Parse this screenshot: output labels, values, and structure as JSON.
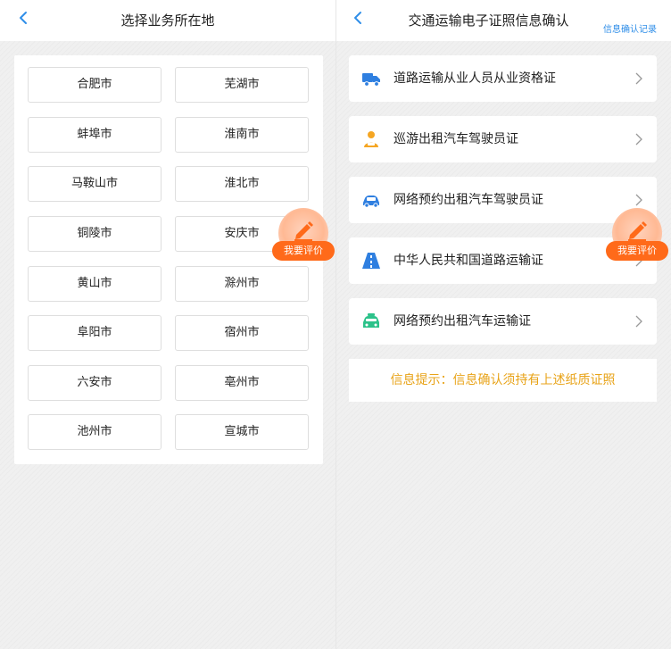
{
  "left": {
    "title": "选择业务所在地",
    "cities": [
      "合肥市",
      "芜湖市",
      "蚌埠市",
      "淮南市",
      "马鞍山市",
      "淮北市",
      "铜陵市",
      "安庆市",
      "黄山市",
      "滁州市",
      "阜阳市",
      "宿州市",
      "六安市",
      "亳州市",
      "池州市",
      "宣城市"
    ]
  },
  "right": {
    "title": "交通运输电子证照信息确认",
    "record_link": "信息确认记录",
    "items": [
      {
        "label": "道路运输从业人员从业资格证",
        "icon": "truck-icon"
      },
      {
        "label": "巡游出租汽车驾驶员证",
        "icon": "driver-icon"
      },
      {
        "label": "网络预约出租汽车驾驶员证",
        "icon": "car-icon"
      },
      {
        "label": "中华人民共和国道路运输证",
        "icon": "road-icon"
      },
      {
        "label": "网络预约出租汽车运输证",
        "icon": "taxi-icon"
      }
    ],
    "notice": "信息提示：信息确认须持有上述纸质证照"
  },
  "evaluate": {
    "label": "我要评价"
  },
  "colors": {
    "accent": "#2f8ee8",
    "orange": "#ff6a1a",
    "notice": "#e8a318"
  }
}
